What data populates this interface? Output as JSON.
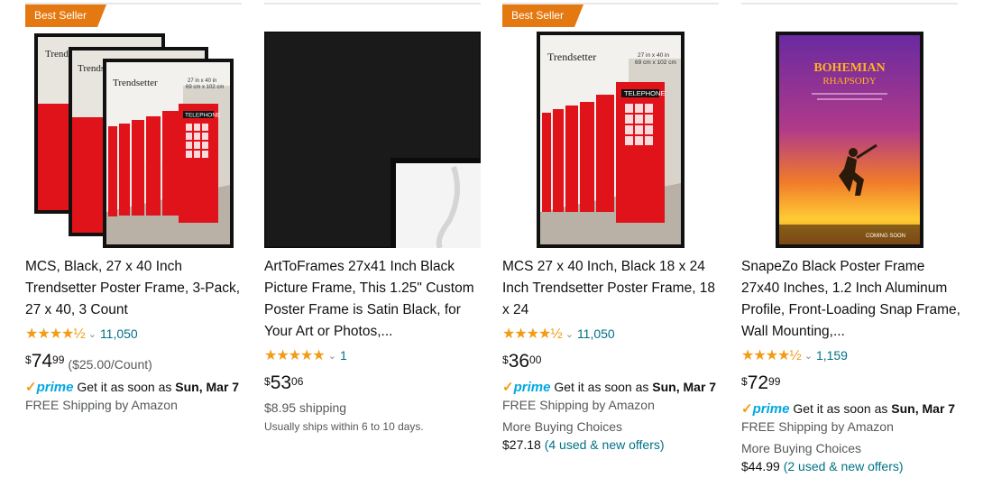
{
  "products": [
    {
      "badge": "Best Seller",
      "title": "MCS, Black, 27 x 40 Inch Trendsetter Poster Frame, 3-Pack, 27 x 40, 3 Count",
      "stars": "★★★★½",
      "rating_count": "11,050",
      "price_symbol": "$",
      "price_whole": "74",
      "price_fraction": "99",
      "unit_price": "($25.00/Count)",
      "prime_label": "prime",
      "delivery_prefix": "Get it as soon as ",
      "delivery_date": "Sun, Mar 7",
      "shipping": "FREE Shipping by Amazon",
      "frame_brand": "Trendsetter",
      "frame_size": "27 in x 40 in / 69 cm x 102 cm",
      "booth_sign": "TELEPHONE"
    },
    {
      "title": "ArtToFrames 27x41 Inch Black Picture Frame, This 1.25\" Custom Poster Frame is Satin Black, for Your Art or Photos,...",
      "stars": "★★★★★",
      "rating_count": "1",
      "price_symbol": "$",
      "price_whole": "53",
      "price_fraction": "06",
      "shipping_cost": "$8.95 shipping",
      "ships_note": "Usually ships within 6 to 10 days."
    },
    {
      "badge": "Best Seller",
      "title": "MCS 27 x 40 Inch, Black 18 x 24 Inch Trendsetter Poster Frame, 18 x 24",
      "stars": "★★★★½",
      "rating_count": "11,050",
      "price_symbol": "$",
      "price_whole": "36",
      "price_fraction": "00",
      "prime_label": "prime",
      "delivery_prefix": "Get it as soon as ",
      "delivery_date": "Sun, Mar 7",
      "shipping": "FREE Shipping by Amazon",
      "more_choices": "More Buying Choices",
      "more_price": "$27.18",
      "more_offers": "(4 used & new offers)",
      "frame_brand": "Trendsetter",
      "frame_size": "27 in x 40 in / 69 cm x 102 cm",
      "booth_sign": "TELEPHONE"
    },
    {
      "title": "SnapeZo Black Poster Frame 27x40 Inches, 1.2 Inch Aluminum Profile, Front-Loading Snap Frame, Wall Mounting,...",
      "stars": "★★★★½",
      "rating_count": "1,159",
      "price_symbol": "$",
      "price_whole": "72",
      "price_fraction": "99",
      "prime_label": "prime",
      "delivery_prefix": "Get it as soon as ",
      "delivery_date": "Sun, Mar 7",
      "shipping": "FREE Shipping by Amazon",
      "more_choices": "More Buying Choices",
      "more_price": "$44.99",
      "more_offers": "(2 used & new offers)",
      "poster_title_1": "BOHEMIAN",
      "poster_title_2": "RHAPSODY",
      "poster_footer": "COMING SOON"
    }
  ],
  "colors": {
    "badge": "#e47911",
    "star": "#f29b16",
    "link": "#007185",
    "prime": "#00a8e1",
    "telephone_red": "#e0121a"
  }
}
